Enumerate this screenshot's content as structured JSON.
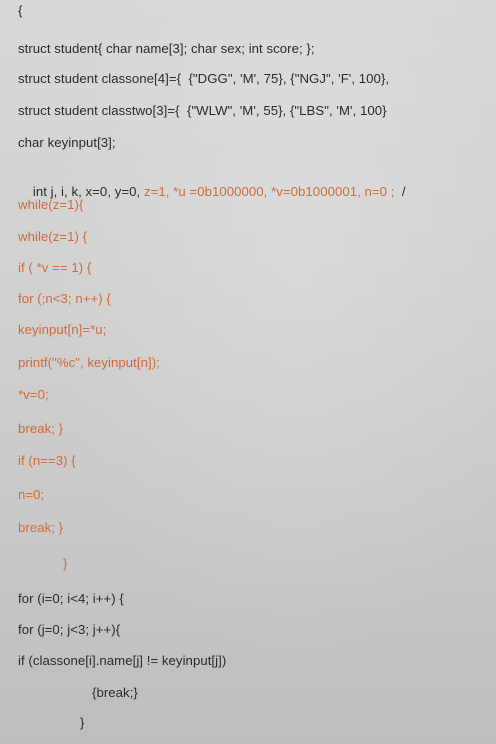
{
  "document": {
    "lines": [
      {
        "segments": [
          {
            "text": "{",
            "color": "black"
          }
        ]
      },
      {
        "segments": [
          {
            "text": "struct student{ char name[3]; char sex; int score; };",
            "color": "black"
          }
        ]
      },
      {
        "segments": [
          {
            "text": "struct student classone[4]={  {\"DGG\", 'M', 75}, {\"NGJ\", 'F', 100},",
            "color": "black"
          }
        ]
      },
      {
        "segments": [
          {
            "text": "struct student classtwo[3]={  {\"WLW\", 'M', 55}, {\"LBS\", 'M', 100}",
            "color": "black"
          }
        ]
      },
      {
        "segments": [
          {
            "text": "char keyinput[3];",
            "color": "black"
          }
        ]
      },
      {
        "segments": [
          {
            "text": "int j, i, k, x=0, y=0, ",
            "color": "black"
          },
          {
            "text": "z=1, *u =0b1000000, *v=0b1000001, n=0 ;",
            "color": "orange"
          },
          {
            "text": "  /",
            "color": "black"
          }
        ]
      },
      {
        "segments": [
          {
            "text": "while(z=1){",
            "color": "orange"
          }
        ]
      },
      {
        "segments": [
          {
            "text": "while(z=1) {",
            "color": "orange"
          }
        ]
      },
      {
        "segments": [
          {
            "text": "if ( *v == 1) {",
            "color": "orange"
          }
        ]
      },
      {
        "segments": [
          {
            "text": "for (;n<3; n++) {",
            "color": "orange"
          }
        ]
      },
      {
        "segments": [
          {
            "text": "keyinput[n]=*u;",
            "color": "orange"
          }
        ]
      },
      {
        "segments": [
          {
            "text": "printf(\"%c\", keyinput[n]);",
            "color": "orange"
          }
        ]
      },
      {
        "segments": [
          {
            "text": "*v=0;",
            "color": "orange"
          }
        ]
      },
      {
        "segments": [
          {
            "text": "break; }",
            "color": "orange"
          }
        ]
      },
      {
        "segments": [
          {
            "text": "if (n==3) {",
            "color": "orange"
          }
        ]
      },
      {
        "segments": [
          {
            "text": "n=0;",
            "color": "orange"
          }
        ]
      },
      {
        "segments": [
          {
            "text": "break; }",
            "color": "orange"
          }
        ]
      },
      {
        "segments": [
          {
            "text": "}",
            "color": "orange"
          }
        ]
      },
      {
        "segments": [
          {
            "text": "for (i=0; i<4; i++) {",
            "color": "black"
          }
        ]
      },
      {
        "segments": [
          {
            "text": "for (j=0; j<3; j++){",
            "color": "black"
          }
        ]
      },
      {
        "segments": [
          {
            "text": "if (classone[i].name[j] != keyinput[j])",
            "color": "black"
          }
        ]
      },
      {
        "segments": [
          {
            "text": "{break;}",
            "color": "black"
          }
        ]
      },
      {
        "segments": [
          {
            "text": "}",
            "color": "black"
          }
        ]
      }
    ]
  },
  "colors": {
    "text": "#2b2b2b",
    "orange": "#d06a3a",
    "paper": "#d2d2d2"
  }
}
